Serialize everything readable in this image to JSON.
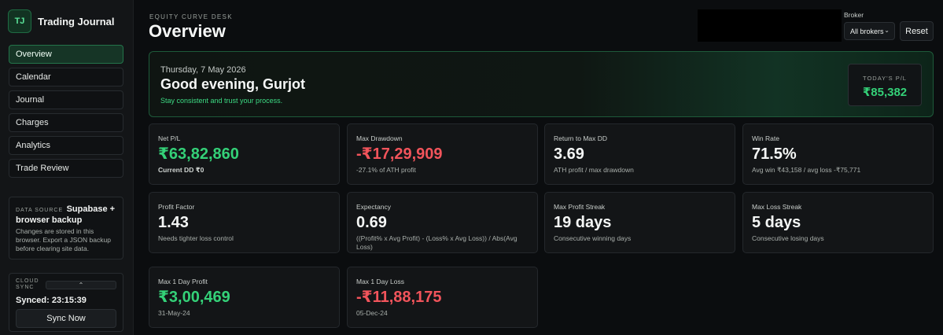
{
  "brand": {
    "logo": "TJ",
    "name": "Trading Journal"
  },
  "nav": [
    {
      "label": "Overview",
      "active": true
    },
    {
      "label": "Calendar"
    },
    {
      "label": "Journal"
    },
    {
      "label": "Charges"
    },
    {
      "label": "Analytics"
    },
    {
      "label": "Trade Review"
    }
  ],
  "data_source": {
    "label": "DATA SOURCE",
    "value": "Supabase + browser backup",
    "desc": "Changes are stored in this browser. Export a JSON backup before clearing site data."
  },
  "cloud": {
    "label": "CLOUD SYNC",
    "toggle_icon": "chevron-up-icon",
    "toggle_glyph": "⌃",
    "synced": "Synced: 23:15:39",
    "button": "Sync Now"
  },
  "header": {
    "eyebrow": "EQUITY CURVE DESK",
    "title": "Overview",
    "broker_label": "Broker",
    "broker_value": "All brokers",
    "reset": "Reset"
  },
  "hero": {
    "date": "Thursday, 7 May 2026",
    "greeting": "Good evening, Gurjot",
    "tagline": "Stay consistent and trust your process.",
    "today_label": "TODAY'S P/L",
    "today_value": "₹85,382"
  },
  "cards": [
    {
      "label": "Net P/L",
      "value": "₹63,82,860",
      "tone": "pos",
      "sub": "Current DD ₹0",
      "sub_bold": true
    },
    {
      "label": "Max Drawdown",
      "value": "-₹17,29,909",
      "tone": "neg",
      "sub": "-27.1% of ATH profit"
    },
    {
      "label": "Return to Max DD",
      "value": "3.69",
      "tone": "neutral",
      "sub": "ATH profit / max drawdown"
    },
    {
      "label": "Win Rate",
      "value": "71.5%",
      "tone": "neutral",
      "sub": "Avg win ₹43,158 / avg loss -₹75,771"
    },
    {
      "label": "Profit Factor",
      "value": "1.43",
      "tone": "neutral",
      "sub": "Needs tighter loss control"
    },
    {
      "label": "Expectancy",
      "value": "0.69",
      "tone": "neutral",
      "sub": "((Profit% x Avg Profit) - (Loss% x Avg Loss)) / Abs(Avg Loss)"
    },
    {
      "label": "Max Profit Streak",
      "value": "19 days",
      "tone": "neutral",
      "sub": "Consecutive winning days"
    },
    {
      "label": "Max Loss Streak",
      "value": "5 days",
      "tone": "neutral",
      "sub": "Consecutive losing days"
    },
    {
      "label": "Max 1 Day Profit",
      "value": "₹3,00,469",
      "tone": "pos",
      "sub": "31-May-24"
    },
    {
      "label": "Max 1 Day Loss",
      "value": "-₹11,88,175",
      "tone": "neg",
      "sub": "05-Dec-24"
    }
  ],
  "colors": {
    "accent": "#34d178",
    "negative": "#f2545b",
    "background": "#0b0d0f"
  }
}
